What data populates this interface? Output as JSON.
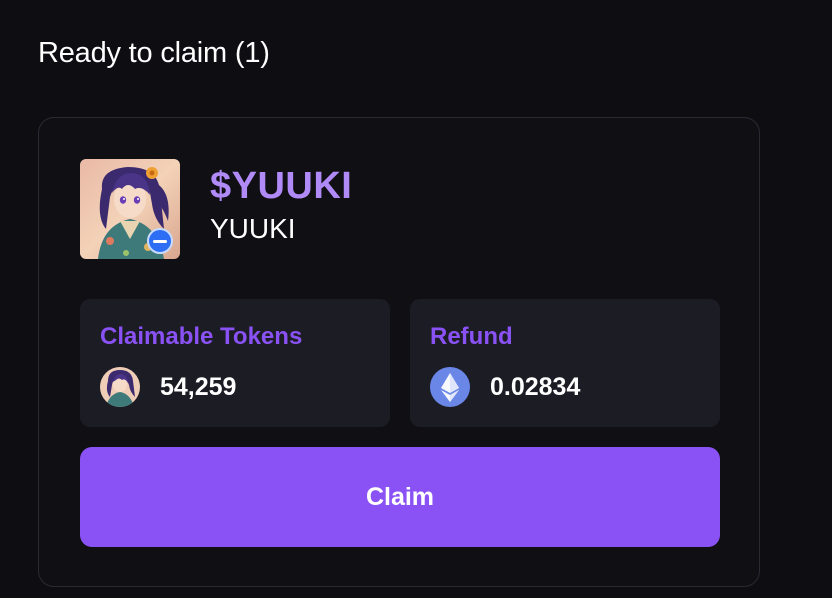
{
  "section": {
    "title": "Ready to claim (1)"
  },
  "token": {
    "ticker": "$YUUKI",
    "name": "YUUKI",
    "avatar_icon": "anime-girl-avatar",
    "chain_badge_icon": "base-chain-icon"
  },
  "claimable": {
    "label": "Claimable Tokens",
    "value": "54,259",
    "icon": "token-avatar-icon"
  },
  "refund": {
    "label": "Refund",
    "value": "0.02834",
    "icon": "ethereum-icon"
  },
  "actions": {
    "claim_label": "Claim"
  },
  "colors": {
    "background": "#0d0d12",
    "card_border": "#2a2a33",
    "panel": "#1c1c24",
    "accent": "#8a52f5",
    "ticker": "#b08af7",
    "eth": "#6a87e8"
  }
}
